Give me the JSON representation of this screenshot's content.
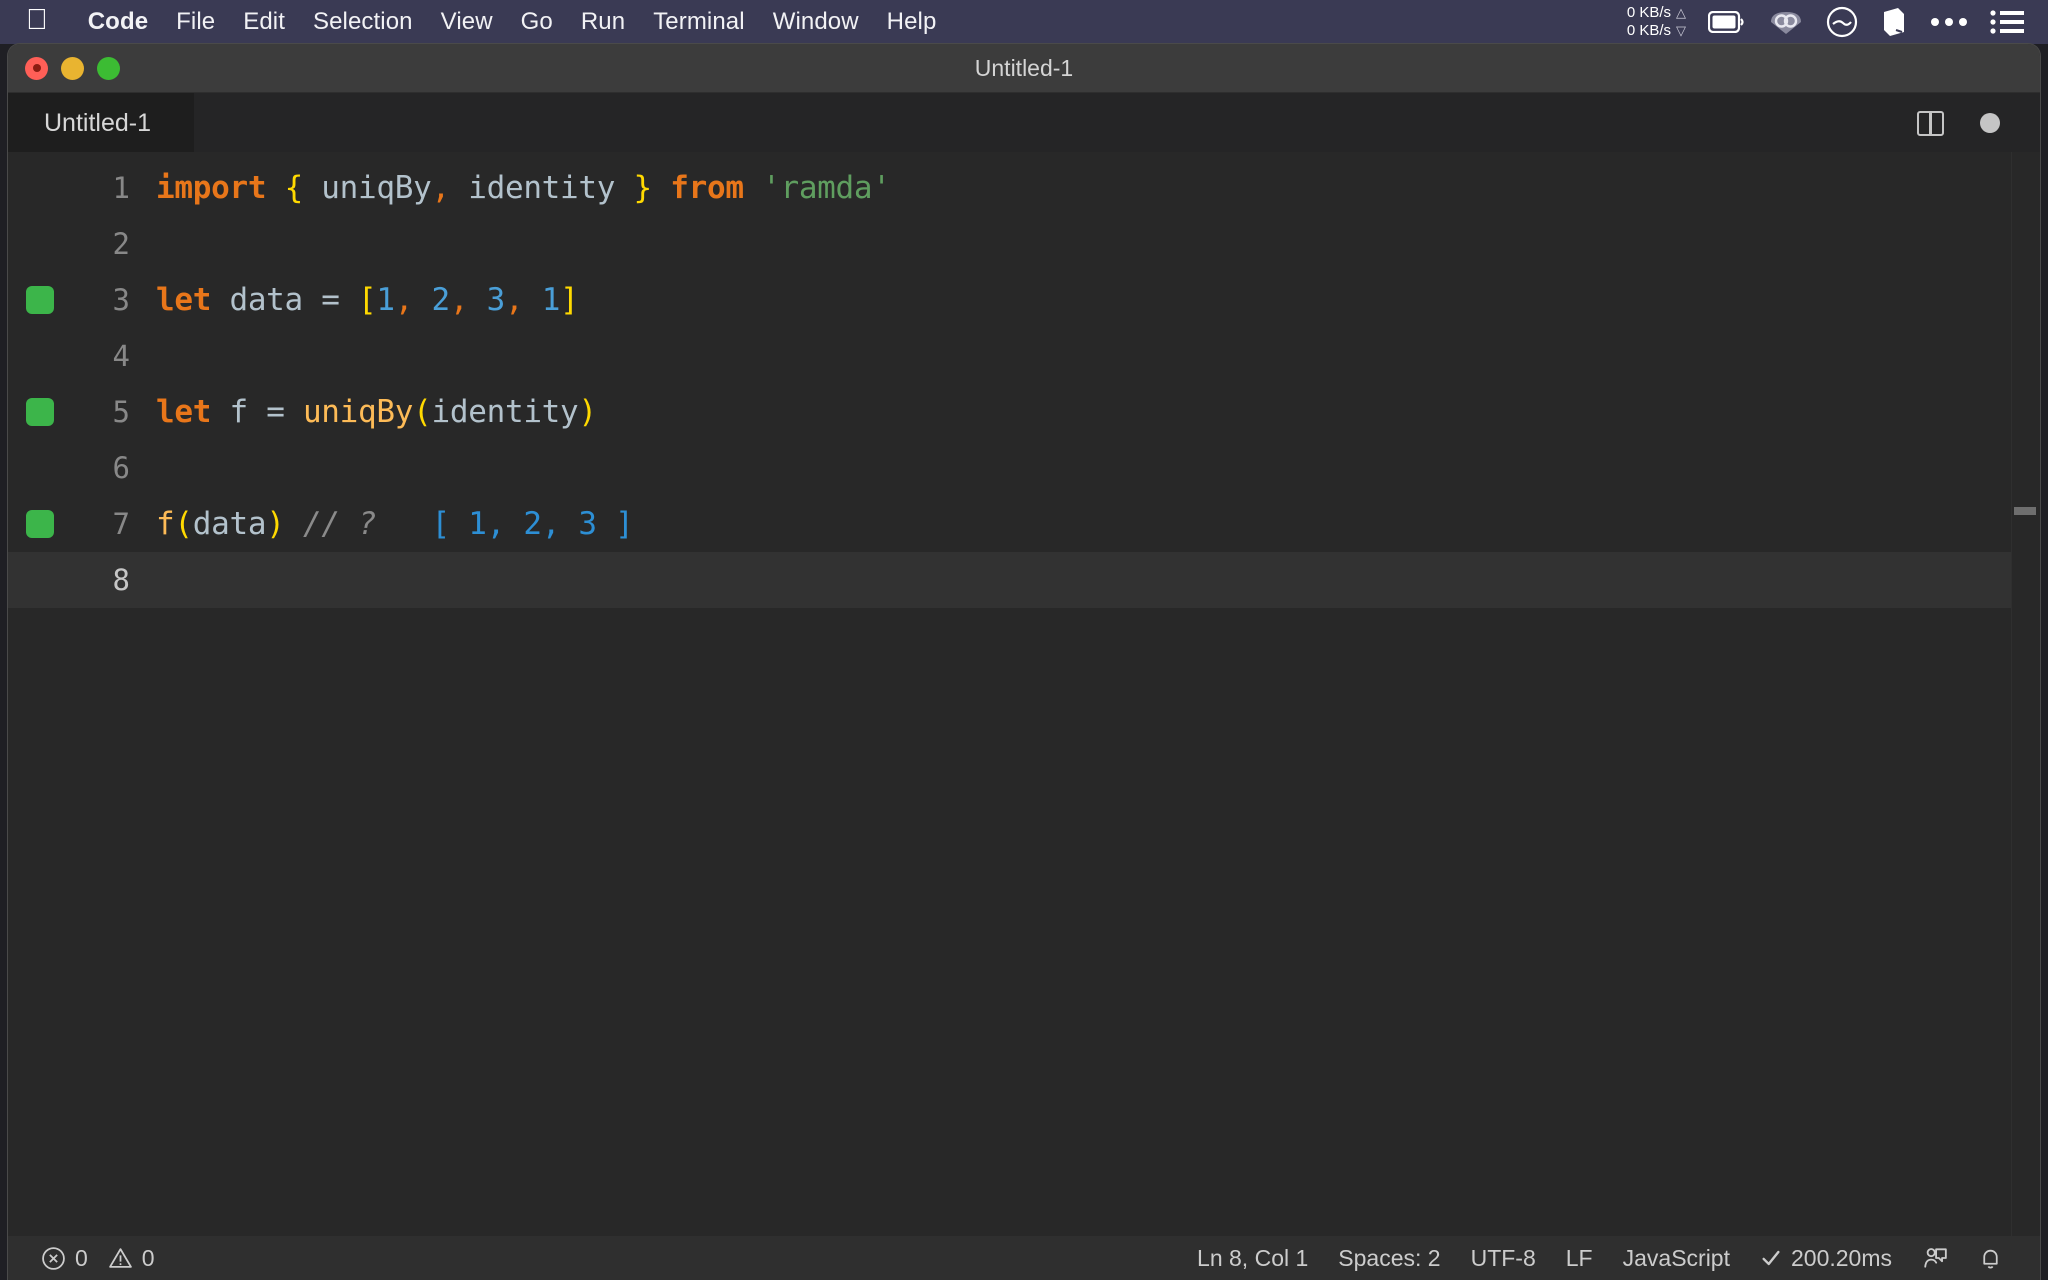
{
  "menubar": {
    "apple_icon": "apple-logo-icon",
    "items": [
      {
        "label": "Code",
        "bold": true
      },
      {
        "label": "File",
        "bold": false
      },
      {
        "label": "Edit",
        "bold": false
      },
      {
        "label": "Selection",
        "bold": false
      },
      {
        "label": "View",
        "bold": false
      },
      {
        "label": "Go",
        "bold": false
      },
      {
        "label": "Run",
        "bold": false
      },
      {
        "label": "Terminal",
        "bold": false
      },
      {
        "label": "Window",
        "bold": false
      },
      {
        "label": "Help",
        "bold": false
      }
    ],
    "network": {
      "upload": "0 KB/s",
      "download": "0 KB/s",
      "up_arrow": "△",
      "down_arrow": "▽"
    },
    "tray": [
      "battery-icon",
      "cloud-sync-icon",
      "speedometer-icon",
      "box-icon",
      "ellipsis-icon",
      "list-menu-icon"
    ]
  },
  "window": {
    "title": "Untitled-1",
    "traffic_lights": [
      "close-button",
      "minimize-button",
      "maximize-button"
    ]
  },
  "tabbar": {
    "tabs": [
      {
        "label": "Untitled-1",
        "active": true
      }
    ],
    "actions": [
      "split-editor-icon",
      "unsaved-indicator-dot"
    ]
  },
  "editor": {
    "lines": [
      {
        "number": "1",
        "breakpoint": false,
        "active": false,
        "tokens": [
          {
            "text": "import",
            "cls": "t-kw"
          },
          {
            "text": " ",
            "cls": "t-var"
          },
          {
            "text": "{",
            "cls": "t-brace"
          },
          {
            "text": " uniqBy",
            "cls": "t-var"
          },
          {
            "text": ",",
            "cls": "t-comma"
          },
          {
            "text": " identity ",
            "cls": "t-var"
          },
          {
            "text": "}",
            "cls": "t-brace"
          },
          {
            "text": " ",
            "cls": "t-var"
          },
          {
            "text": "from",
            "cls": "t-kw"
          },
          {
            "text": " ",
            "cls": "t-var"
          },
          {
            "text": "'ramda'",
            "cls": "t-str"
          }
        ]
      },
      {
        "number": "2",
        "breakpoint": false,
        "active": false,
        "tokens": []
      },
      {
        "number": "3",
        "breakpoint": true,
        "active": false,
        "tokens": [
          {
            "text": "let",
            "cls": "t-kw"
          },
          {
            "text": " data ",
            "cls": "t-var"
          },
          {
            "text": "=",
            "cls": "t-op"
          },
          {
            "text": " ",
            "cls": "t-var"
          },
          {
            "text": "[",
            "cls": "t-brace"
          },
          {
            "text": "1",
            "cls": "t-num"
          },
          {
            "text": ",",
            "cls": "t-comma"
          },
          {
            "text": " ",
            "cls": "t-var"
          },
          {
            "text": "2",
            "cls": "t-num"
          },
          {
            "text": ",",
            "cls": "t-comma"
          },
          {
            "text": " ",
            "cls": "t-var"
          },
          {
            "text": "3",
            "cls": "t-num"
          },
          {
            "text": ",",
            "cls": "t-comma"
          },
          {
            "text": " ",
            "cls": "t-var"
          },
          {
            "text": "1",
            "cls": "t-num"
          },
          {
            "text": "]",
            "cls": "t-brace"
          }
        ]
      },
      {
        "number": "4",
        "breakpoint": false,
        "active": false,
        "tokens": []
      },
      {
        "number": "5",
        "breakpoint": true,
        "active": false,
        "tokens": [
          {
            "text": "let",
            "cls": "t-kw"
          },
          {
            "text": " f ",
            "cls": "t-var"
          },
          {
            "text": "=",
            "cls": "t-op"
          },
          {
            "text": " ",
            "cls": "t-var"
          },
          {
            "text": "uniqBy",
            "cls": "t-fn"
          },
          {
            "text": "(",
            "cls": "t-paren"
          },
          {
            "text": "identity",
            "cls": "t-var"
          },
          {
            "text": ")",
            "cls": "t-paren"
          }
        ]
      },
      {
        "number": "6",
        "breakpoint": false,
        "active": false,
        "tokens": []
      },
      {
        "number": "7",
        "breakpoint": true,
        "active": false,
        "tokens": [
          {
            "text": "f",
            "cls": "t-fn"
          },
          {
            "text": "(",
            "cls": "t-paren"
          },
          {
            "text": "data",
            "cls": "t-var"
          },
          {
            "text": ")",
            "cls": "t-paren"
          },
          {
            "text": " ",
            "cls": "t-var"
          },
          {
            "text": "// ?",
            "cls": "t-comment"
          },
          {
            "text": "   [ 1, 2, 3 ]",
            "cls": "t-result"
          }
        ]
      },
      {
        "number": "8",
        "breakpoint": false,
        "active": true,
        "tokens": []
      }
    ]
  },
  "statusbar": {
    "errors_icon": "error-circle-icon",
    "errors_count": "0",
    "warnings_icon": "warning-triangle-icon",
    "warnings_count": "0",
    "cursor_position": "Ln 8, Col 1",
    "indentation": "Spaces: 2",
    "encoding": "UTF-8",
    "line_ending": "LF",
    "language": "JavaScript",
    "run_status_icon": "check-icon",
    "run_time": "200.20ms",
    "live_share_icon": "live-share-icon",
    "notifications_icon": "bell-icon"
  },
  "colors": {
    "menubar_bg": "#3a3a54",
    "titlebar_bg": "#3c3c3c",
    "editor_bg": "#282828",
    "statusbar_bg": "#2f2f2f",
    "breakpoint_green": "#3cb54a",
    "keyword_orange": "#e8761a",
    "brace_yellow": "#ffd900",
    "number_blue": "#4a9fd8",
    "string_green": "#5f9e5f",
    "result_blue": "#2d8fd5"
  }
}
